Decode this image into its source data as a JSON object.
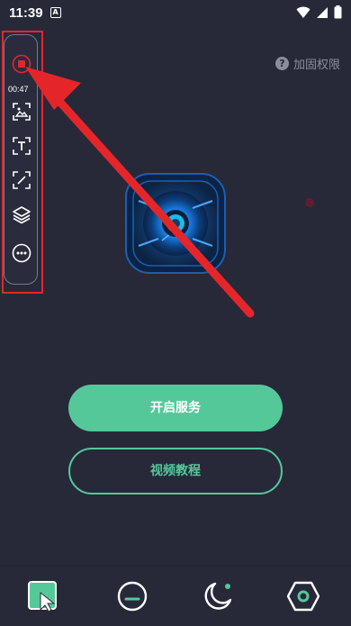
{
  "status_bar": {
    "time": "11:39",
    "notification_letter": "A"
  },
  "header": {
    "strengthen_label": "加固权限",
    "help_icon": "help-circle-icon"
  },
  "floating_toolbar": {
    "timer": "00:47",
    "tools": [
      "stop-record-icon",
      "screenshot-icon",
      "text-recognition-icon",
      "crop-icon",
      "layers-icon",
      "more-icon"
    ]
  },
  "main": {
    "start_button_label": "开启服务",
    "video_button_label": "视频教程"
  },
  "bottom_nav": {
    "items": [
      "click-cursor-icon",
      "minus-circle-icon",
      "moon-icon",
      "settings-hexagon-icon"
    ]
  },
  "colors": {
    "background": "#272939",
    "accent_green": "#55c89a",
    "glow_blue": "#1e8cff",
    "annotation_red": "#e4262b"
  }
}
